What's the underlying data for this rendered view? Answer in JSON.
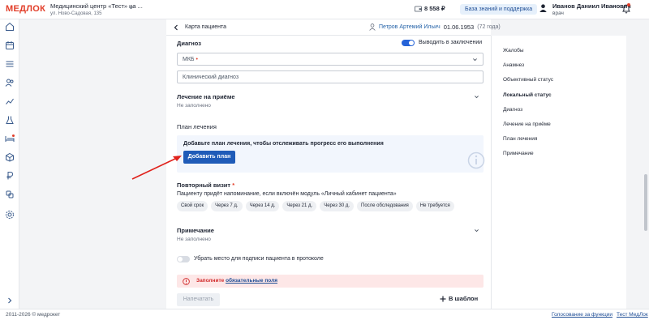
{
  "topbar": {
    "logo": "МЕДЛОК",
    "clinic_name": "Медицинский центр «Тест» на ...",
    "clinic_address": "ул. Ново-Садовая, 135",
    "balance": "8 558 ₽",
    "knowledge_button": "База знаний и поддержка",
    "user_name": "Иванов Даниил Иванович",
    "user_role": "врач"
  },
  "header": {
    "title": "Карта пациента",
    "patient_name": "Петров Артемий Ильич",
    "patient_dob": "01.06.1953",
    "patient_age": "(72 года)"
  },
  "main": {
    "diagnosis_title": "Диагноз",
    "show_in_conclusion_label": "Выводить в заключении",
    "show_in_conclusion": true,
    "mkb_label": "МКБ",
    "clinical_diagnosis_placeholder": "Клинический диагноз",
    "treatment_title": "Лечение на приёме",
    "treatment_value": "Не заполнено",
    "plan_title": "План лечения",
    "plan_prompt": "Добавьте план лечения, чтобы отслеживать прогресс его выполнения",
    "add_plan_button": "Добавить план",
    "revisit_title": "Повторный визит",
    "revisit_hint": "Пациенту придёт напоминание, если включён модуль «Личный кабинет пациента»",
    "revisit_options": [
      "Свой срок",
      "Через 7 д.",
      "Через 14 д.",
      "Через 21 д.",
      "Через 30 д.",
      "После обследования",
      "Не требуется"
    ],
    "note_title": "Примечание",
    "note_value": "Не заполнено",
    "hide_signature_label": "Убрать место для подписи пациента в протоколе",
    "hide_signature": false,
    "alert_text": "Заполните ",
    "alert_link": "обязательные поля",
    "print_button": "Напечатать",
    "template_button": "В шаблон"
  },
  "right_nav": {
    "items": [
      "Жалобы",
      "Анамнез",
      "Объективный статус",
      "Локальный статус",
      "Диагноз",
      "Лечение на приёме",
      "План лечения",
      "Примечание"
    ],
    "active_index": 3
  },
  "footer": {
    "copyright": "2011-2026 © медрокет",
    "vote_link": "Голосование за функции",
    "test_link": "Тест МедЛок"
  },
  "colors": {
    "brand": "#e23d28",
    "primary": "#1f5bb8",
    "link": "#1f4e96",
    "alert_bg": "#fde7e7"
  },
  "sidebar_icons": [
    "home-icon",
    "calendar-icon",
    "list-icon",
    "patients-icon",
    "analytics-icon",
    "lab-icon",
    "bed-icon",
    "box-icon",
    "ruble-icon",
    "integrations-icon",
    "settings-icon",
    "expand-icon"
  ]
}
